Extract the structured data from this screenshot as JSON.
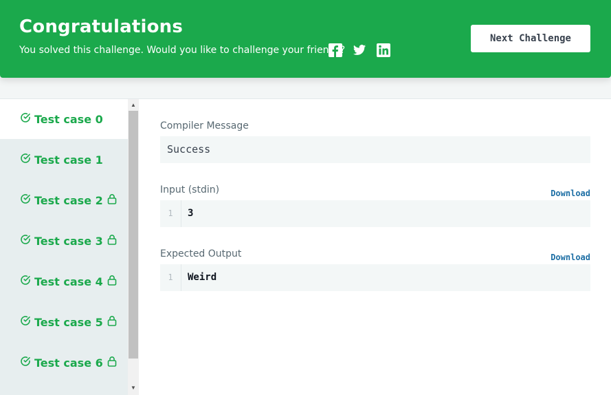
{
  "banner": {
    "title": "Congratulations",
    "subtitle": "You solved this challenge. Would you like to challenge your friends?",
    "share_icons": [
      "facebook-icon",
      "twitter-icon",
      "linkedin-icon"
    ],
    "next_button_label": "Next Challenge",
    "background_color": "#1ba94c"
  },
  "test_cases": [
    {
      "label": "Test case 0",
      "locked": false,
      "active": true
    },
    {
      "label": "Test case 1",
      "locked": false,
      "active": false
    },
    {
      "label": "Test case 2",
      "locked": true,
      "active": false
    },
    {
      "label": "Test case 3",
      "locked": true,
      "active": false
    },
    {
      "label": "Test case 4",
      "locked": true,
      "active": false
    },
    {
      "label": "Test case 5",
      "locked": true,
      "active": false
    },
    {
      "label": "Test case 6",
      "locked": true,
      "active": false
    }
  ],
  "result": {
    "compiler_label": "Compiler Message",
    "compiler_message": "Success",
    "input_label": "Input (stdin)",
    "input_download": "Download",
    "input_line_no": "1",
    "input_value": "3",
    "output_label": "Expected Output",
    "output_download": "Download",
    "output_line_no": "1",
    "output_value": "Weird"
  }
}
